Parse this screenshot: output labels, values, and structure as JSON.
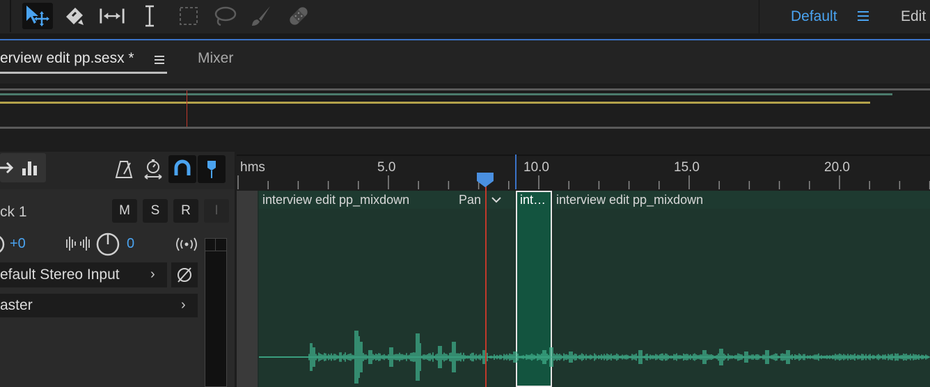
{
  "toolbar": {
    "tools": [
      "move-tool",
      "razor-tool",
      "slip-tool",
      "time-selection-tool",
      "marquee-tool",
      "lasso-tool",
      "brush-tool",
      "spot-healing-tool"
    ],
    "workspace": "Default",
    "edit_label": "Edit"
  },
  "tabs": {
    "file": "erview edit pp.sesx *",
    "mixer": "Mixer"
  },
  "ruler": {
    "labels": [
      "hms",
      "5.0",
      "10.0",
      "15.0",
      "20.0"
    ]
  },
  "track": {
    "name": "ck 1",
    "mute": "M",
    "solo": "S",
    "record": "R",
    "input_monitor": "I",
    "volume": "+0",
    "pan": "0",
    "input": "efault Stereo Input",
    "output": "aster"
  },
  "clips": [
    {
      "name": "interview edit pp_mixdown",
      "extra": "Pan"
    },
    {
      "name": "int…"
    },
    {
      "name": "interview edit pp_mixdown"
    }
  ],
  "colors": {
    "accent": "#4aa3f0",
    "clip": "#1e362d",
    "waveform": "#3fb08c",
    "playhead": "#c0392b"
  }
}
